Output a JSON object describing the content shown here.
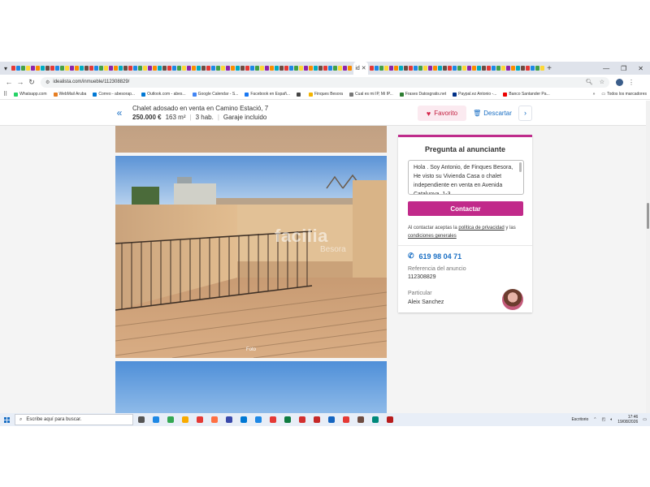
{
  "browser": {
    "active_tab_icon": "id",
    "address": "idealista.com/inmueble/112308829/",
    "bookmarks": [
      {
        "label": "Whatsapp.com",
        "color": "#25d366"
      },
      {
        "label": "WebMail Aruba",
        "color": "#e67e22"
      },
      {
        "label": "Correo - abesorap...",
        "color": "#0078d4"
      },
      {
        "label": "Outlook.com - abes...",
        "color": "#0078d4"
      },
      {
        "label": "Google Calendar - S...",
        "color": "#4285f4"
      },
      {
        "label": "Facebook en Españ...",
        "color": "#1877f2"
      },
      {
        "label": "",
        "color": "#444444"
      },
      {
        "label": "Finques Besora",
        "color": "#f4b400"
      },
      {
        "label": "Cual es mi IP, Mi IP...",
        "color": "#777777"
      },
      {
        "label": "Frases Datosgratis.net",
        "color": "#2e7d32"
      },
      {
        "label": "Paypal.ez Antonio -...",
        "color": "#003087"
      },
      {
        "label": "Banco Santander Pa...",
        "color": "#ec0000"
      }
    ],
    "bookmarks_more": "»",
    "all_bookmarks": "Todos los marcadores"
  },
  "listing": {
    "title": "Chalet adosado en venta en Camino Estació, 7",
    "price": "250.000 €",
    "area": "163 m²",
    "rooms": "3 hab.",
    "garage": "Garaje incluido",
    "favorite_label": "Favorito",
    "discard_label": "Descartar",
    "photo_caption": "Foto",
    "watermark": "facilia",
    "watermark_sub": "Besora"
  },
  "contact": {
    "title": "Pregunta al anunciante",
    "message": "Hola . Soy Antonio, de Finques Besora, He visto su Vivienda Casa o chalet independiente en venta en Avenida Catalunya, 1-3",
    "button": "Contactar",
    "legal_prefix": "Al contactar aceptas la ",
    "privacy_link": "política de privacidad",
    "legal_middle": " y las ",
    "terms_link": "condiciones generales",
    "phone": "619 98 04 71",
    "ref_label": "Referencia del anuncio",
    "ref_value": "112308829",
    "owner_type": "Particular",
    "owner_name": "Aleix Sanchez"
  },
  "taskbar": {
    "search_placeholder": "Escribe aquí para buscar.",
    "desktop_label": "Escritorio",
    "time": "17:46",
    "date": "19/08/2026"
  },
  "colors": {
    "accent": "#c12a8a",
    "link": "#1a6fc4",
    "favorite": "#d6244a"
  }
}
